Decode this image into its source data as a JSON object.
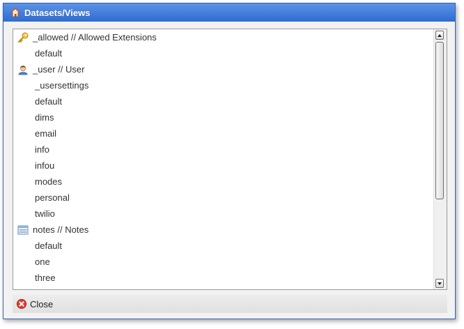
{
  "window": {
    "title": "Datasets/Views",
    "title_icon": "home-icon"
  },
  "list": {
    "rows": [
      {
        "type": "group",
        "icon": "key-icon",
        "label": "_allowed // Allowed Extensions"
      },
      {
        "type": "child",
        "label": "default"
      },
      {
        "type": "group",
        "icon": "user-icon",
        "label": "_user // User"
      },
      {
        "type": "child",
        "label": "_usersettings"
      },
      {
        "type": "child",
        "label": "default"
      },
      {
        "type": "child",
        "label": "dims"
      },
      {
        "type": "child",
        "label": "email"
      },
      {
        "type": "child",
        "label": "info"
      },
      {
        "type": "child",
        "label": "infou"
      },
      {
        "type": "child",
        "label": "modes"
      },
      {
        "type": "child",
        "label": "personal"
      },
      {
        "type": "child",
        "label": "twilio"
      },
      {
        "type": "group",
        "icon": "table-icon",
        "label": "notes // Notes"
      },
      {
        "type": "child",
        "label": "default"
      },
      {
        "type": "child",
        "label": "one"
      },
      {
        "type": "child",
        "label": "three"
      }
    ]
  },
  "footer": {
    "close_label": "Close",
    "close_icon": "close-icon"
  },
  "colors": {
    "titlebar_top": "#5c93e6",
    "titlebar_bottom": "#2f6cd2",
    "close_red": "#e23b2e"
  }
}
